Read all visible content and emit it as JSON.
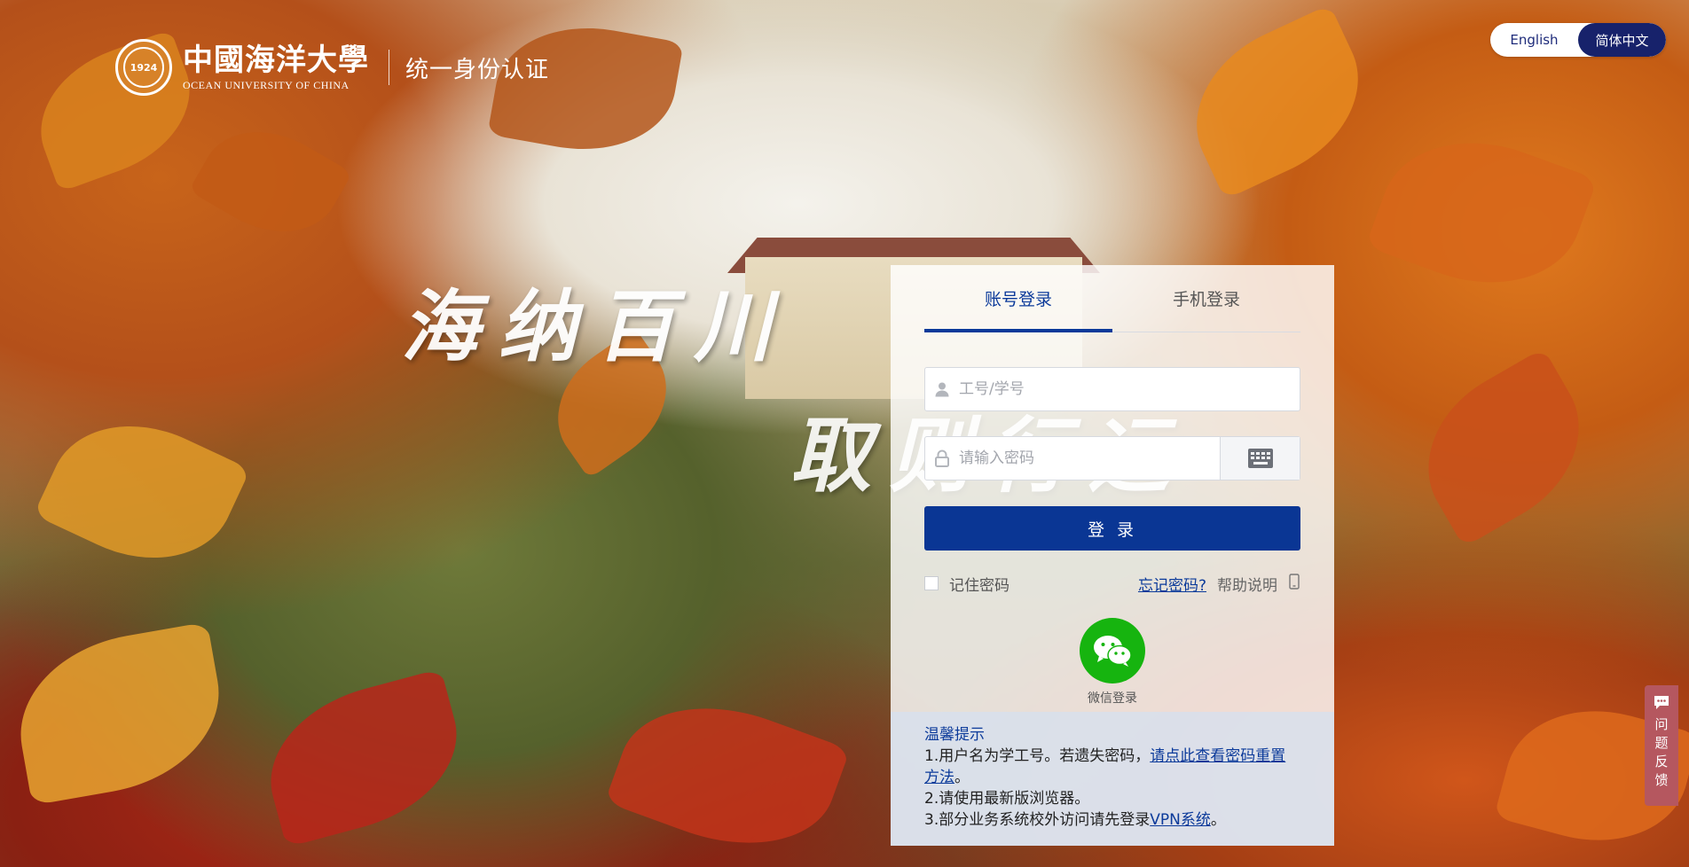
{
  "header": {
    "uni_cn": "中國海洋大學",
    "uni_en": "OCEAN UNIVERSITY OF CHINA",
    "emblem_year": "1924",
    "system_name": "统一身份认证"
  },
  "language": {
    "english": "English",
    "chinese": "简体中文",
    "active": "简体中文"
  },
  "slogan": {
    "line1": "海纳百川",
    "line2": "取则行远"
  },
  "login": {
    "tabs": [
      {
        "label": "账号登录",
        "active": true
      },
      {
        "label": "手机登录",
        "active": false
      }
    ],
    "username_placeholder": "工号/学号",
    "password_placeholder": "请输入密码",
    "submit_label": "登 录",
    "remember_label": "记住密码",
    "forgot_label": "忘记密码?",
    "help_label": "帮助说明",
    "wechat_label": "微信登录"
  },
  "tips": {
    "title": "温馨提示",
    "line1_prefix": "1.用户名为学工号。若遗失密码，",
    "line1_link": "请点此查看密码重置方法",
    "line1_suffix": "。",
    "line2": "2.请使用最新版浏览器。",
    "line3_prefix": "3.部分业务系统校外访问请先登录",
    "line3_link": "VPN系统",
    "line3_suffix": "。"
  },
  "feedback": {
    "label": "问题反馈"
  },
  "colors": {
    "primary": "#0a3694",
    "lang_active": "#17226b",
    "wechat": "#16b40f",
    "feedback": "#b5575f"
  }
}
